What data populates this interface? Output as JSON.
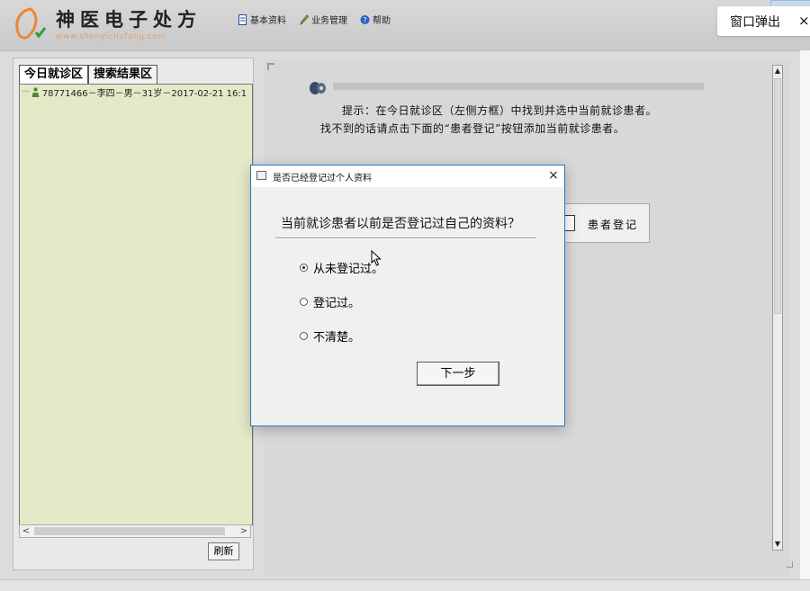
{
  "header": {
    "app_title": "神医电子处方",
    "app_url": "www.shenyichufang.com",
    "nav": [
      {
        "label": "基本资料",
        "icon": "document-icon"
      },
      {
        "label": "业务管理",
        "icon": "pen-icon"
      },
      {
        "label": "帮助",
        "icon": "help-icon"
      }
    ],
    "popup_button": {
      "label": "窗口弹出",
      "close": "×"
    }
  },
  "left_panel": {
    "tabs": [
      {
        "label": "今日就诊区",
        "active": true
      },
      {
        "label": "搜索结果区",
        "active": false
      }
    ],
    "patients": [
      {
        "label": "78771466－李四－男－31岁－2017-02-21 16:1"
      }
    ],
    "scroll_left": "<",
    "scroll_right": ">",
    "refresh_label": "刷新"
  },
  "main": {
    "hint_line1": "提示：在今日就诊区（左侧方框）中找到并选中当前就诊患者。",
    "hint_line2": "找不到的话请点击下面的“患者登记”按钮添加当前就诊患者。",
    "register_button": "患者登记"
  },
  "dialog": {
    "title": "是否已经登记过个人资料",
    "close": "×",
    "question": "当前就诊患者以前是否登记过自己的资料？",
    "options": [
      {
        "label": "从未登记过。",
        "checked": true
      },
      {
        "label": "登记过。",
        "checked": false
      },
      {
        "label": "不清楚。",
        "checked": false
      }
    ],
    "next_button": "下一步"
  },
  "colors": {
    "dialog_border": "#2a78c9",
    "tree_background": "#e4eac8",
    "logo_orange": "#e8883a",
    "logo_check": "#2f9a3a"
  }
}
